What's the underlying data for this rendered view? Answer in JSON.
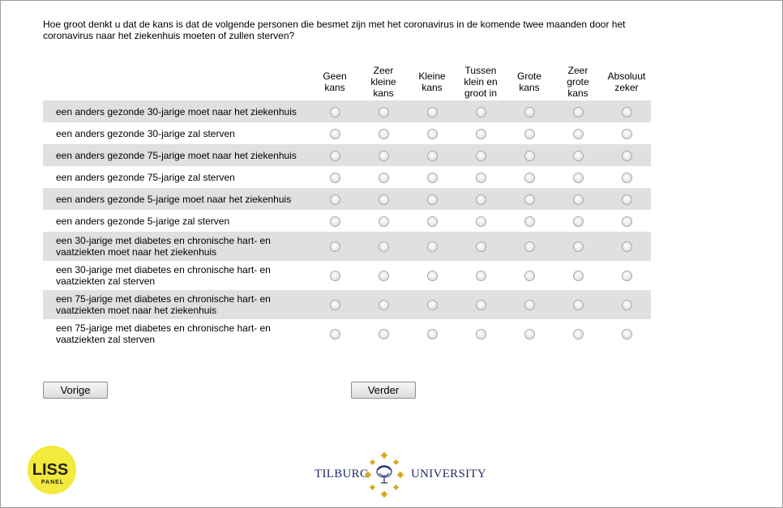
{
  "question": "Hoe groot denkt u dat de kans is dat de volgende personen die besmet zijn met het coronavirus in de komende twee maanden door het coronavirus naar het ziekenhuis moeten of zullen sterven?",
  "columns": [
    [
      "Geen",
      "kans"
    ],
    [
      "Zeer",
      "kleine",
      "kans"
    ],
    [
      "Kleine",
      "kans"
    ],
    [
      "Tussen",
      "klein en",
      "groot in"
    ],
    [
      "Grote",
      "kans"
    ],
    [
      "Zeer",
      "grote",
      "kans"
    ],
    [
      "Absoluut",
      "zeker"
    ]
  ],
  "rows": [
    [
      "een anders gezonde 30-jarige moet naar het ziekenhuis"
    ],
    [
      "een anders gezonde 30-jarige zal sterven"
    ],
    [
      "een anders gezonde 75-jarige moet naar het ziekenhuis"
    ],
    [
      "een anders gezonde 75-jarige zal sterven"
    ],
    [
      "een anders gezonde 5-jarige moet naar het ziekenhuis"
    ],
    [
      "een anders gezonde 5-jarige zal sterven"
    ],
    [
      "een 30-jarige met diabetes en chronische hart- en",
      "vaatziekten moet naar het ziekenhuis"
    ],
    [
      "een 30-jarige met diabetes en chronische hart- en",
      "vaatziekten zal sterven"
    ],
    [
      "een 75-jarige met diabetes en chronische hart- en",
      "vaatziekten moet naar het ziekenhuis"
    ],
    [
      "een 75-jarige met diabetes en chronische hart- en",
      "vaatziekten zal sterven"
    ]
  ],
  "buttons": {
    "prev": "Vorige",
    "next": "Verder"
  },
  "logos": {
    "liss_top": "LISS",
    "liss_bottom": "PANEL",
    "tilburg_left": "TILBURG",
    "tilburg_right": "UNIVERSITY"
  },
  "colors": {
    "liss_yellow": "#f2ea3c",
    "tilburg_blue": "#1f2d6b",
    "tilburg_gold": "#d8a920",
    "row_alt": "#e0e0e0"
  }
}
